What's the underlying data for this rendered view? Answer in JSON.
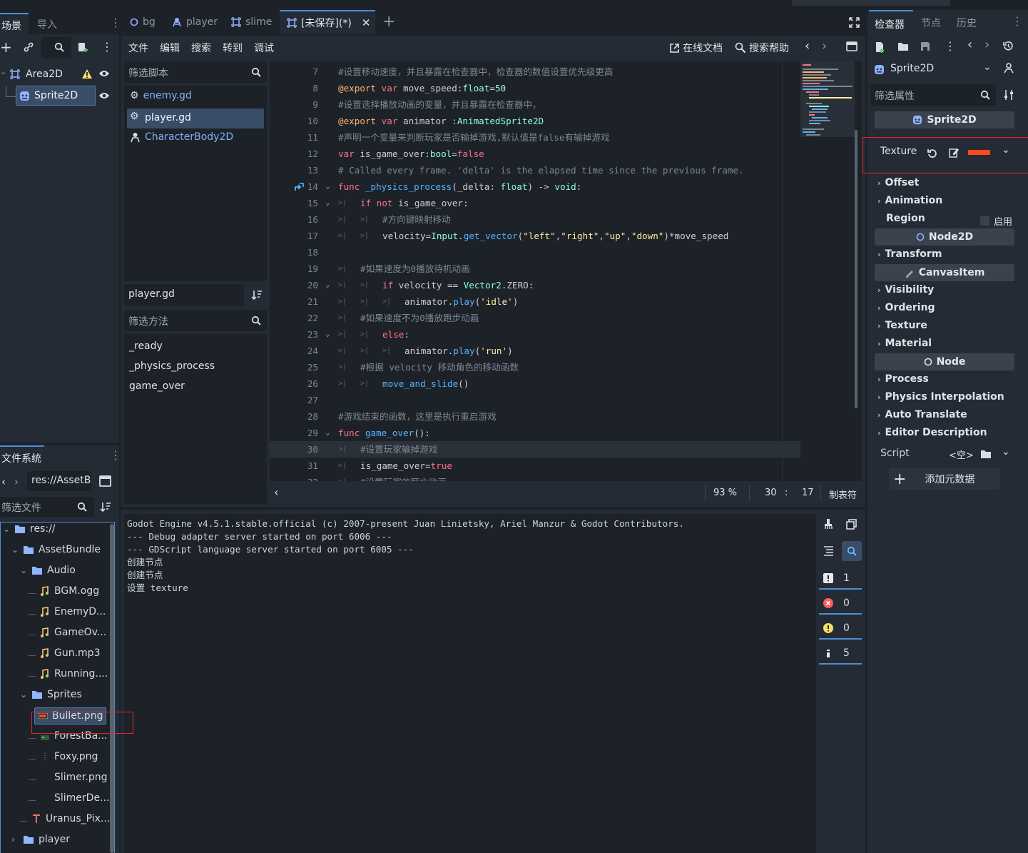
{
  "left_dock": {
    "tabs": [
      "场景",
      "导入"
    ],
    "scene_tree": [
      {
        "name": "Area2D"
      },
      {
        "name": "Sprite2D"
      }
    ]
  },
  "filesystem": {
    "title": "文件系统",
    "path": "res://AssetB",
    "filter_placeholder": "筛选文件",
    "items": [
      {
        "name": "res://",
        "kind": "folder"
      },
      {
        "name": "AssetBundle",
        "kind": "folder"
      },
      {
        "name": "Audio",
        "kind": "folder"
      },
      {
        "name": "BGM.ogg",
        "kind": "audio"
      },
      {
        "name": "EnemyD...",
        "kind": "audio"
      },
      {
        "name": "GameOv...",
        "kind": "audio"
      },
      {
        "name": "Gun.mp3",
        "kind": "audio"
      },
      {
        "name": "Running....",
        "kind": "audio"
      },
      {
        "name": "Sprites",
        "kind": "folder"
      },
      {
        "name": "Bullet.png",
        "kind": "image-red"
      },
      {
        "name": "ForestBa...",
        "kind": "image-green"
      },
      {
        "name": "Foxy.png",
        "kind": "image-dot"
      },
      {
        "name": "Slimer.png",
        "kind": "image-none"
      },
      {
        "name": "SlimerDe...",
        "kind": "image-none"
      },
      {
        "name": "Uranus_Pix...",
        "kind": "font"
      },
      {
        "name": "player",
        "kind": "folder"
      }
    ]
  },
  "editor_tabs": [
    {
      "label": "bg",
      "icon": "circle-icon"
    },
    {
      "label": "player",
      "icon": "character-icon"
    },
    {
      "label": "slime",
      "icon": "area-icon"
    },
    {
      "label": "[未保存](*)",
      "icon": "area-icon"
    }
  ],
  "script_menu": [
    "文件",
    "编辑",
    "搜索",
    "转到",
    "调试"
  ],
  "script_toolbar": {
    "online_docs": "在线文档",
    "search_help": "搜索帮助"
  },
  "script_list": {
    "filter_placeholder": "筛选脚本",
    "items": [
      "enemy.gd",
      "player.gd",
      "CharacterBody2D"
    ],
    "current": "player.gd",
    "method_filter_placeholder": "筛选方法",
    "methods": [
      "_ready",
      "_physics_process",
      "game_over"
    ]
  },
  "code": {
    "lines": [
      {
        "n": "7",
        "t": "#设置移动速度，并且暴露在检查器中，检查器的数值设置优先级更高"
      },
      {
        "n": "8",
        "t": "@export var move_speed:float=50"
      },
      {
        "n": "9",
        "t": "#设置选择播放动画的变量，并且暴露在检查器中，"
      },
      {
        "n": "10",
        "t": "@export var animator :AnimatedSprite2D"
      },
      {
        "n": "11",
        "t": "#声明一个变量来判断玩家是否输掉游戏,默认值是false有输掉游戏"
      },
      {
        "n": "12",
        "t": "var is_game_over:bool=false"
      },
      {
        "n": "13",
        "t": "# Called every frame. 'delta' is the elapsed time since the previous frame."
      },
      {
        "n": "14",
        "t": "func _physics_process(_delta: float) -> void:"
      },
      {
        "n": "15",
        "t": "if not is_game_over:"
      },
      {
        "n": "16",
        "t": "#方向键映射移动"
      },
      {
        "n": "17",
        "t": "velocity=Input.get_vector(\"left\",\"right\",\"up\",\"down\")*move_speed"
      },
      {
        "n": "18",
        "t": ""
      },
      {
        "n": "19",
        "t": "#如果速度为0播放待机动画"
      },
      {
        "n": "20",
        "t": "if velocity == Vector2.ZERO:"
      },
      {
        "n": "21",
        "t": "animator.play('idle')"
      },
      {
        "n": "22",
        "t": "#如果速度不为0播放跑步动画"
      },
      {
        "n": "23",
        "t": "else:"
      },
      {
        "n": "24",
        "t": "animator.play('run')"
      },
      {
        "n": "25",
        "t": "#根据 velocity 移动角色的移动函数"
      },
      {
        "n": "26",
        "t": "move_and_slide()"
      },
      {
        "n": "27",
        "t": ""
      },
      {
        "n": "28",
        "t": "#游戏结束的函数，这里是执行重启游戏"
      },
      {
        "n": "29",
        "t": "func game_over():"
      },
      {
        "n": "30",
        "t": "#设置玩家输掉游戏"
      },
      {
        "n": "31",
        "t": "is_game_over=true"
      },
      {
        "n": "32",
        "t": "#设置玩家的死亡动画"
      }
    ]
  },
  "status_bar": {
    "zoom": "93 %",
    "line": "30",
    "col": "17",
    "indent": "制表符"
  },
  "output": {
    "lines": [
      "Godot Engine v4.5.1.stable.official (c) 2007-present Juan Linietsky, Ariel Manzur & Godot Contributors.",
      "--- Debug adapter server started on port 6006 ---",
      "--- GDScript language server started on port 6005 ---",
      "创建节点",
      "创建节点",
      "设置 texture"
    ],
    "counts": {
      "log": "1",
      "error": "0",
      "warning": "0",
      "info": "5"
    }
  },
  "inspector": {
    "tabs": [
      "检查器",
      "节点",
      "历史"
    ],
    "object": "Sprite2D",
    "filter_placeholder": "筛选属性",
    "class_sprite": "Sprite2D",
    "texture_label": "Texture",
    "texture_color": "#ff4a1c",
    "sprite_props": [
      "Offset",
      "Animation",
      "Region"
    ],
    "region_toggle": "启用",
    "class_node2d": "Node2D",
    "node2d_props": [
      "Transform"
    ],
    "class_canvas": "CanvasItem",
    "canvas_props": [
      "Visibility",
      "Ordering",
      "Texture",
      "Material"
    ],
    "class_node": "Node",
    "node_props": [
      "Process",
      "Physics Interpolation",
      "Auto Translate",
      "Editor Description"
    ],
    "script_label": "Script",
    "script_value": "<空>",
    "add_metadata": "添加元数据"
  },
  "colors": {
    "bg": "#1d2229",
    "panel": "#252b34",
    "accent": "#4a8fd8",
    "highlight_red": "#e0262e"
  }
}
